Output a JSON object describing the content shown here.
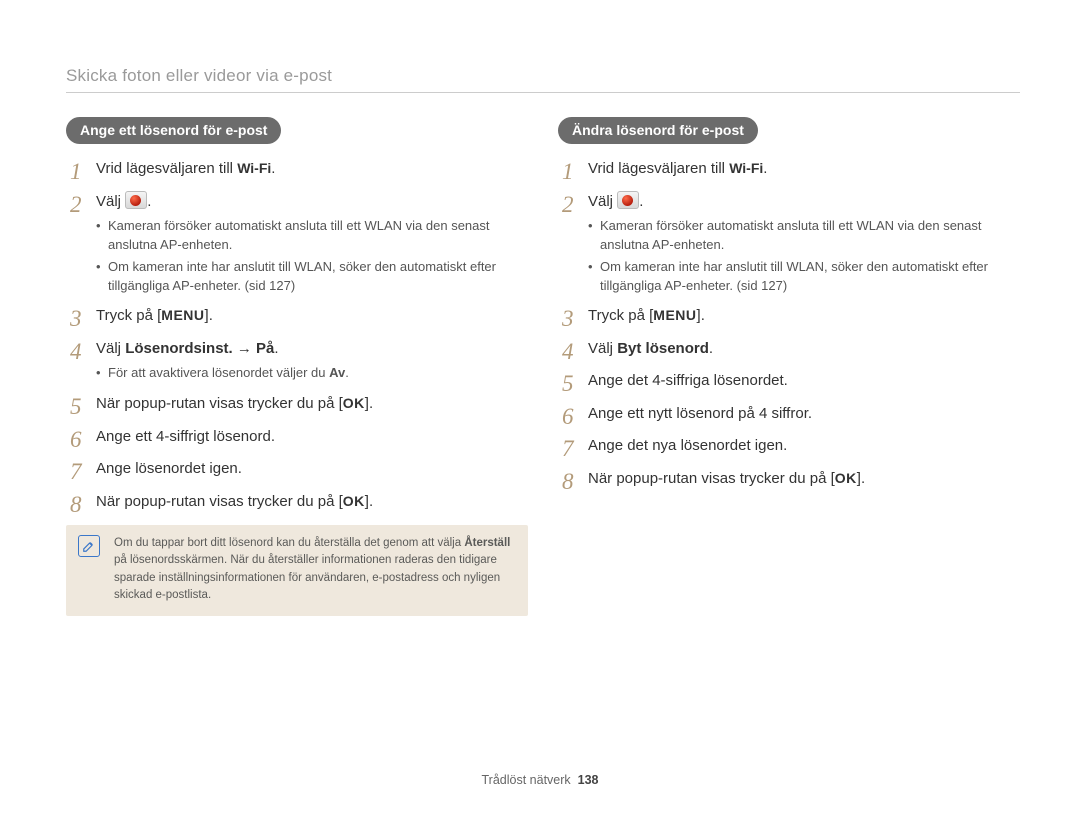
{
  "page_title": "Skicka foton eller videor via e-post",
  "wifi_text": "Wi-Fi",
  "menu_text": "MENU",
  "ok_text": "OK",
  "left": {
    "heading": "Ange ett lösenord för e-post",
    "step1_pre": "Vrid lägesväljaren till ",
    "step1_post": ".",
    "step2_pre": "Välj ",
    "step2_post": ".",
    "step2_bullet1": "Kameran försöker automatiskt ansluta till ett WLAN via den senast anslutna AP-enheten.",
    "step2_bullet2": "Om kameran inte har anslutit till WLAN, söker den automatiskt efter tillgängliga AP-enheter. (sid 127)",
    "step3_pre": "Tryck på [",
    "step3_post": "].",
    "step4_pre": "Välj ",
    "step4_bold": "Lösenordsinst.",
    "step4_arrow": " → ",
    "step4_bold2": "På",
    "step4_post": ".",
    "step4_bullet_pre": "För att avaktivera lösenordet väljer du ",
    "step4_bullet_bold": "Av",
    "step4_bullet_post": ".",
    "step5_pre": "När popup-rutan visas trycker du på [",
    "step5_post": "].",
    "step6": "Ange ett 4-siffrigt lösenord.",
    "step7": "Ange lösenordet igen.",
    "step8_pre": "När popup-rutan visas trycker du på [",
    "step8_post": "].",
    "note_pre": "Om du tappar bort ditt lösenord kan du återställa det genom att välja ",
    "note_bold": "Återställ",
    "note_post": " på lösenordsskärmen. När du återställer informationen raderas den tidigare sparade inställningsinformationen för användaren, e-postadress och nyligen skickad e-postlista."
  },
  "right": {
    "heading": "Ändra lösenord för e-post",
    "step1_pre": "Vrid lägesväljaren till ",
    "step1_post": ".",
    "step2_pre": "Välj ",
    "step2_post": ".",
    "step2_bullet1": "Kameran försöker automatiskt ansluta till ett WLAN via den senast anslutna AP-enheten.",
    "step2_bullet2": "Om kameran inte har anslutit till WLAN, söker den automatiskt efter tillgängliga AP-enheter. (sid 127)",
    "step3_pre": "Tryck på [",
    "step3_post": "].",
    "step4_pre": "Välj ",
    "step4_bold": "Byt lösenord",
    "step4_post": ".",
    "step5": "Ange det 4-siffriga lösenordet.",
    "step6": "Ange ett nytt lösenord på 4 siffror.",
    "step7": "Ange det nya lösenordet igen.",
    "step8_pre": "När popup-rutan visas trycker du på [",
    "step8_post": "]."
  },
  "footer": {
    "section": "Trådlöst nätverk",
    "page_number": "138"
  }
}
